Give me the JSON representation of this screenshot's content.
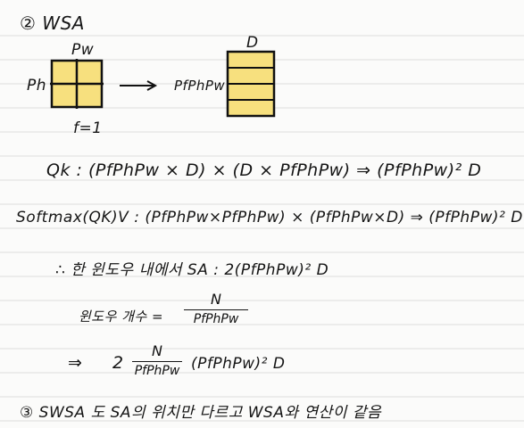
{
  "sections": [
    {
      "marker": "②",
      "title": "WSA"
    },
    {
      "marker": "③",
      "text": "SWSA 도 SA의 위치만 다르고 WSA와 연산이 같음"
    }
  ],
  "diagram": {
    "top_label": "Pw",
    "side_label": "Ph",
    "bottom_label": "f=1",
    "arrow_label": "PfPhPw",
    "matrix_label": "D"
  },
  "equations": {
    "qk": "Qk : (PfPhPw × D) × (D × PfPhPw) ⇒ (PfPhPw)² D",
    "softmax": "Softmax(QK)V : (PfPhPw×PfPhPw) × (PfPhPw×D) ⇒ (PfPhPw)² D",
    "summary": "∴ 한 윈도우 내에서 SA : 2(PfPhPw)² D"
  },
  "window_count": {
    "label": "윈도우 개수 =",
    "numerator": "N",
    "denominator": "PfPhPw"
  },
  "result": {
    "arrow": "⇒",
    "coefficient": "2",
    "numerator": "N",
    "denominator": "PfPhPw",
    "tail": "(PfPhPw)² D"
  }
}
